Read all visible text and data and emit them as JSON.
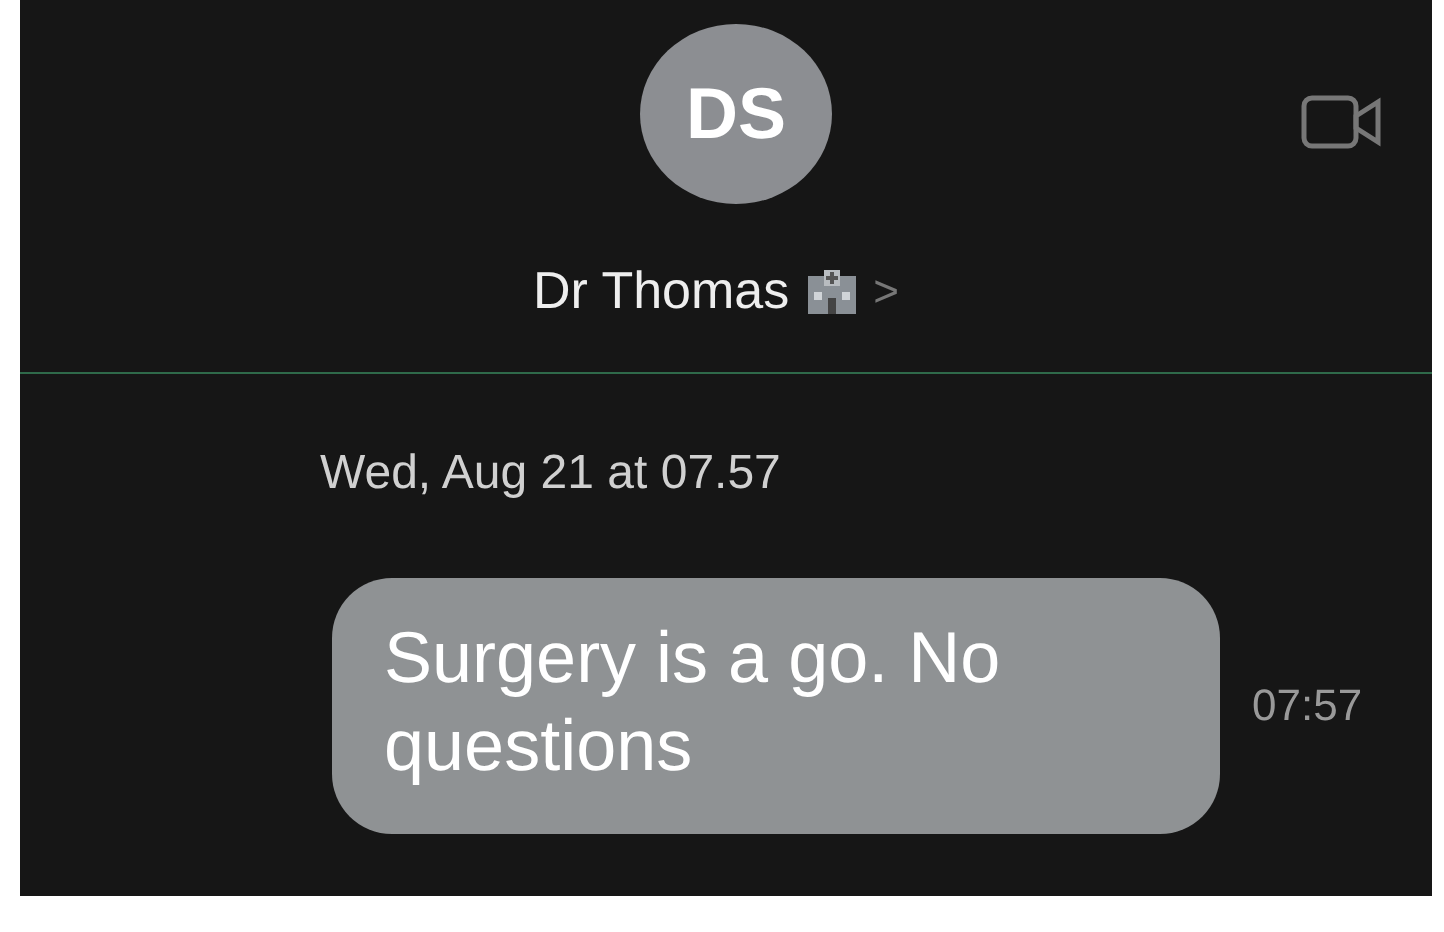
{
  "contact": {
    "initials": "DS",
    "name": "Dr Thomas",
    "chevron": ">"
  },
  "date": "Wed, Aug 21 at 07.57",
  "messages": [
    {
      "text": "Surgery is a go. No questions",
      "time": "07:57"
    }
  ]
}
